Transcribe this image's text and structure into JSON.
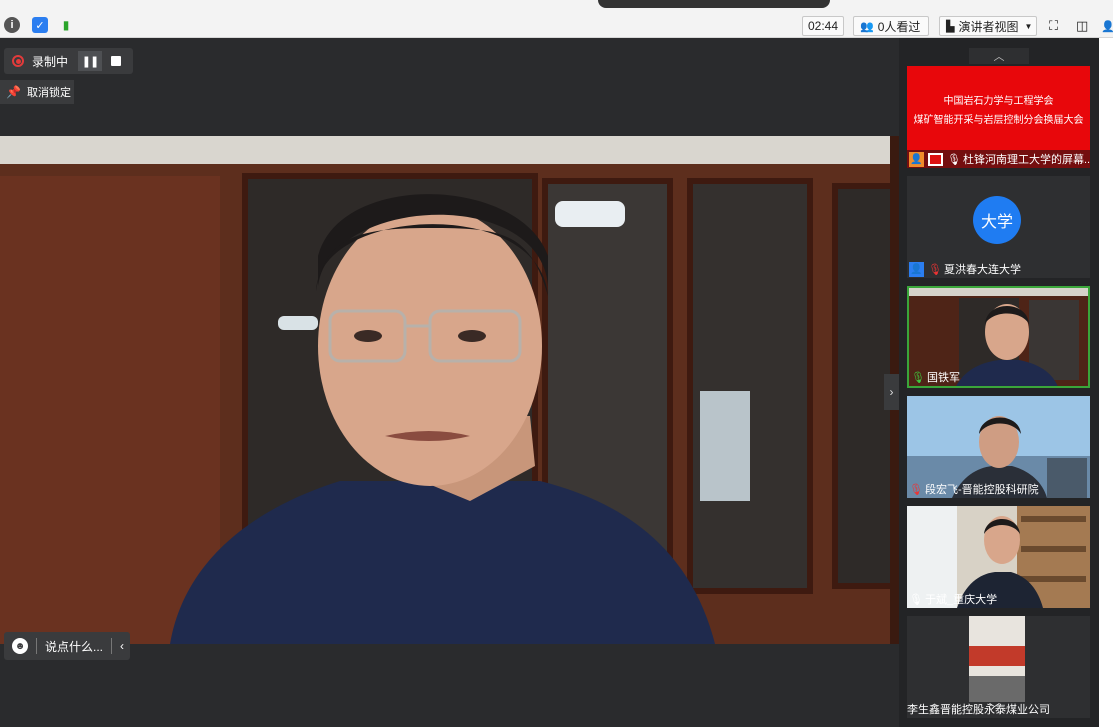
{
  "topbar": {
    "timer": "02:44",
    "viewers": "0人看过",
    "view_mode": "演讲者视图"
  },
  "recording": {
    "label": "录制中"
  },
  "pin": {
    "label": "取消锁定"
  },
  "chat": {
    "placeholder": "说点什么..."
  },
  "slide": {
    "line1": "中国岩石力学与工程学会",
    "line2": "煤矿智能开采与岩层控制分会换届大会"
  },
  "participants": [
    {
      "name": "杜锋河南理工大学的屏幕..."
    },
    {
      "name": "夏洪春大连大学",
      "avatar_text": "大学"
    },
    {
      "name": "国铁军"
    },
    {
      "name": "段宏飞-晋能控股科研院"
    },
    {
      "name": "于斌_重庆大学"
    },
    {
      "name": "李生鑫晋能控股永泰煤业公司"
    }
  ],
  "colors": {
    "recording_red": "#e23b3b",
    "active_speaker": "#3aa63a",
    "avatar_blue": "#1f7cf2",
    "slide_red": "#e8070b"
  }
}
